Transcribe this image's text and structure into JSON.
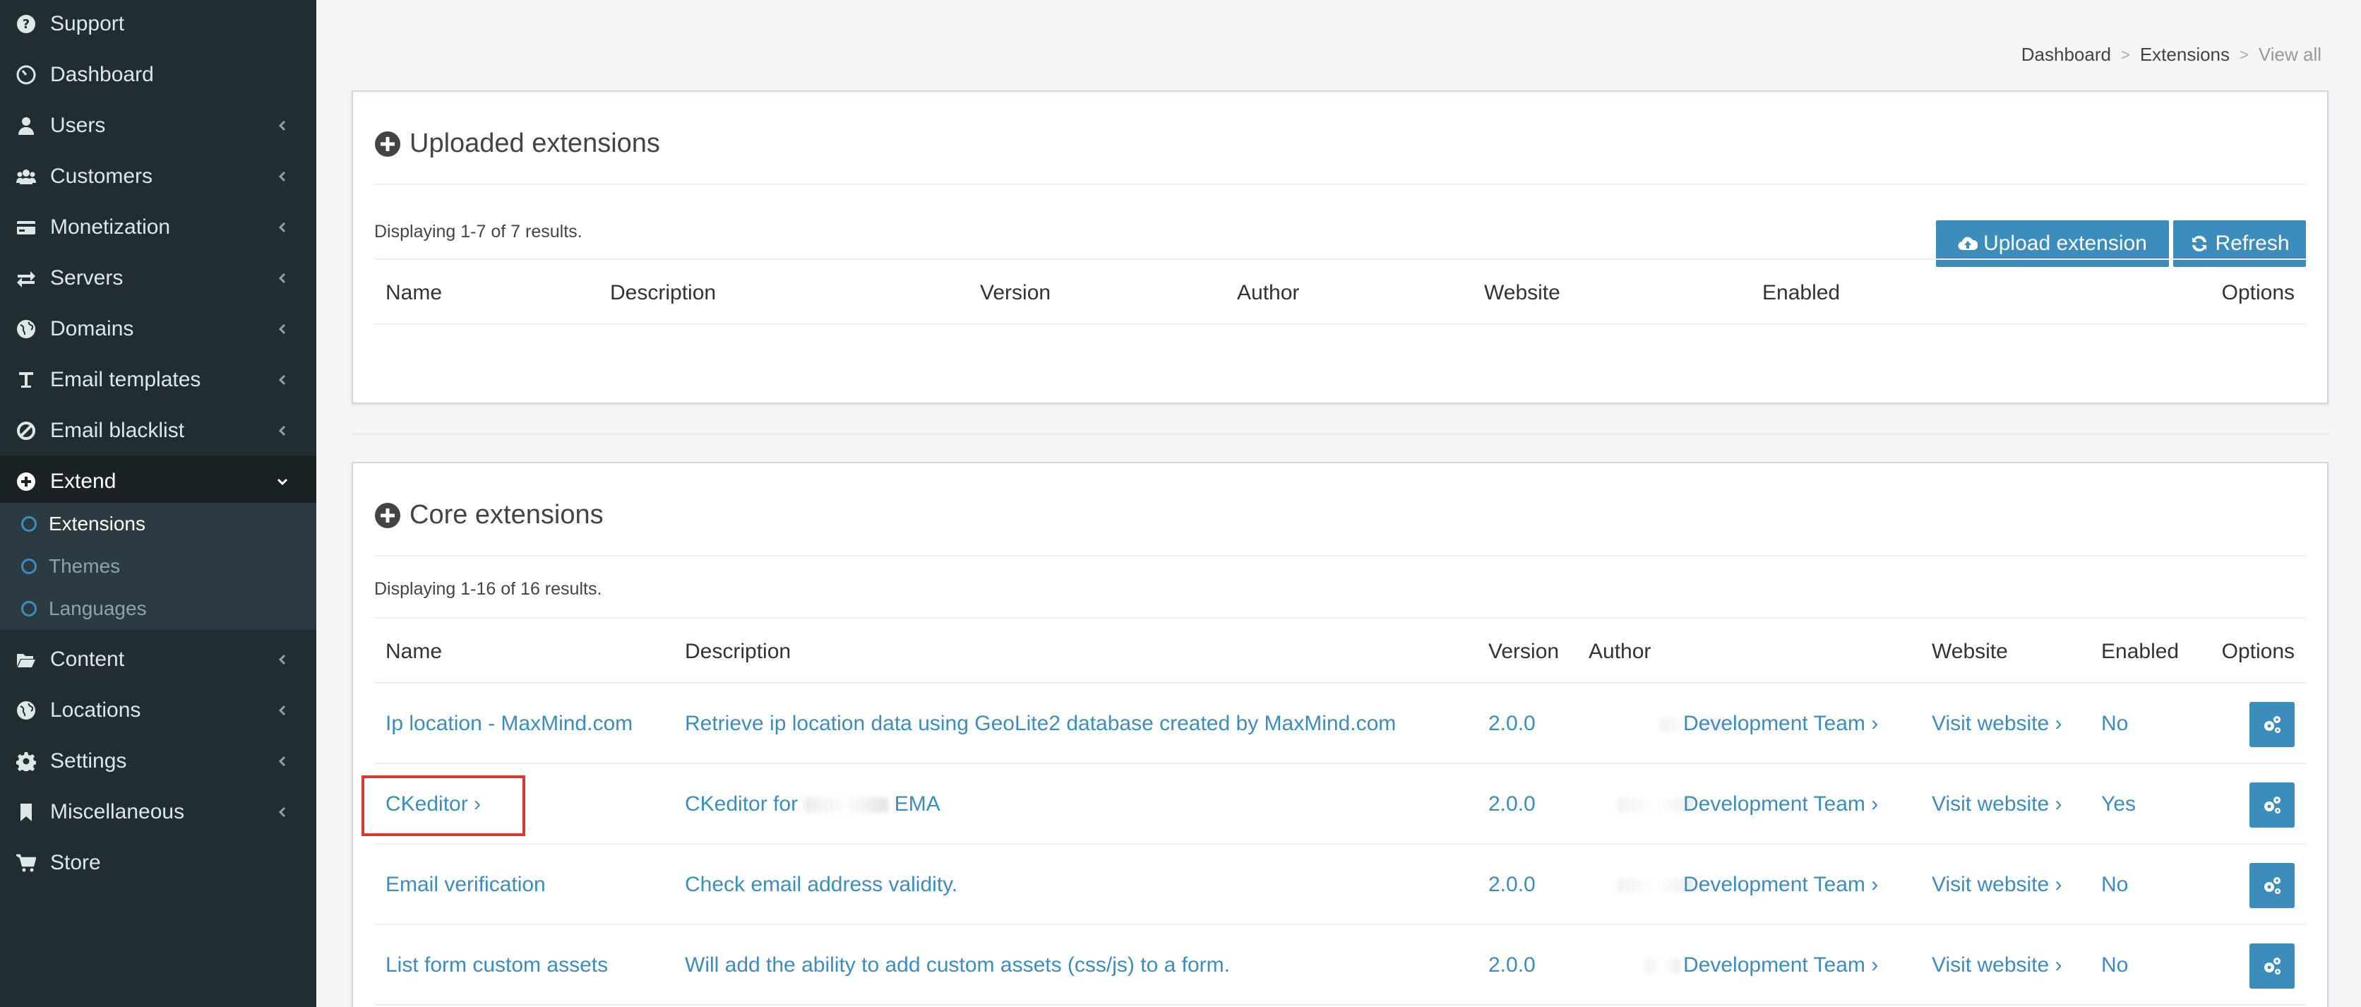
{
  "sidebar": {
    "items": [
      {
        "label": "Support",
        "icon": "question-circle-icon",
        "chevron": false
      },
      {
        "label": "Dashboard",
        "icon": "dashboard-icon",
        "chevron": false
      },
      {
        "label": "Users",
        "icon": "user-icon",
        "chevron": true
      },
      {
        "label": "Customers",
        "icon": "users-icon",
        "chevron": true
      },
      {
        "label": "Monetization",
        "icon": "credit-card-icon",
        "chevron": true
      },
      {
        "label": "Servers",
        "icon": "exchange-icon",
        "chevron": true
      },
      {
        "label": "Domains",
        "icon": "globe-icon",
        "chevron": true
      },
      {
        "label": "Email templates",
        "icon": "text-height-icon",
        "chevron": true
      },
      {
        "label": "Email blacklist",
        "icon": "ban-icon",
        "chevron": true
      },
      {
        "label": "Extend",
        "icon": "plus-circle-icon",
        "chevron": true,
        "expanded": true
      },
      {
        "label": "Content",
        "icon": "folder-open-icon",
        "chevron": true
      },
      {
        "label": "Locations",
        "icon": "globe-icon",
        "chevron": true
      },
      {
        "label": "Settings",
        "icon": "gear-icon",
        "chevron": true
      },
      {
        "label": "Miscellaneous",
        "icon": "bookmark-icon",
        "chevron": true
      },
      {
        "label": "Store",
        "icon": "cart-icon",
        "chevron": false
      }
    ],
    "submenu": [
      {
        "label": "Extensions",
        "current": true
      },
      {
        "label": "Themes"
      },
      {
        "label": "Languages"
      }
    ]
  },
  "breadcrumb": {
    "items": [
      "Dashboard",
      "Extensions"
    ],
    "current": "View all"
  },
  "uploaded": {
    "title": "Uploaded extensions",
    "count_text": "Displaying 1-7 of 7 results.",
    "upload_button": "Upload extension",
    "refresh_button": "Refresh",
    "columns": [
      "Name",
      "Description",
      "Version",
      "Author",
      "Website",
      "Enabled",
      "Options"
    ]
  },
  "core": {
    "title": "Core extensions",
    "count_text": "Displaying 1-16 of 16 results.",
    "columns": [
      "Name",
      "Description",
      "Version",
      "Author",
      "Website",
      "Enabled",
      "Options"
    ],
    "rows": [
      {
        "name": "Ip location - MaxMind.com",
        "description": "Retrieve ip location data using GeoLite2 database created by MaxMind.com",
        "version": "2.0.0",
        "author": "Development Team ›",
        "website": "Visit website ›",
        "enabled": "No"
      },
      {
        "name": "CKeditor ›",
        "description_pre": "CKeditor for",
        "description_post": "EMA",
        "version": "2.0.0",
        "author": "Development Team ›",
        "website": "Visit website ›",
        "enabled": "Yes"
      },
      {
        "name": "Email verification",
        "description": "Check email address validity.",
        "version": "2.0.0",
        "author": "Development Team ›",
        "website": "Visit website ›",
        "enabled": "No"
      },
      {
        "name": "List form custom assets",
        "description": "Will add the ability to add custom assets (css/js) to a form.",
        "version": "2.0.0",
        "author": "Development Team ›",
        "website": "Visit website ›",
        "enabled": "No"
      }
    ]
  },
  "colors": {
    "sidebar_bg": "#222d32",
    "sidebar_active": "#1a2226",
    "submenu_bg": "#2c3b41",
    "accent": "#3c8dbc",
    "highlight": "#d63a2a"
  }
}
